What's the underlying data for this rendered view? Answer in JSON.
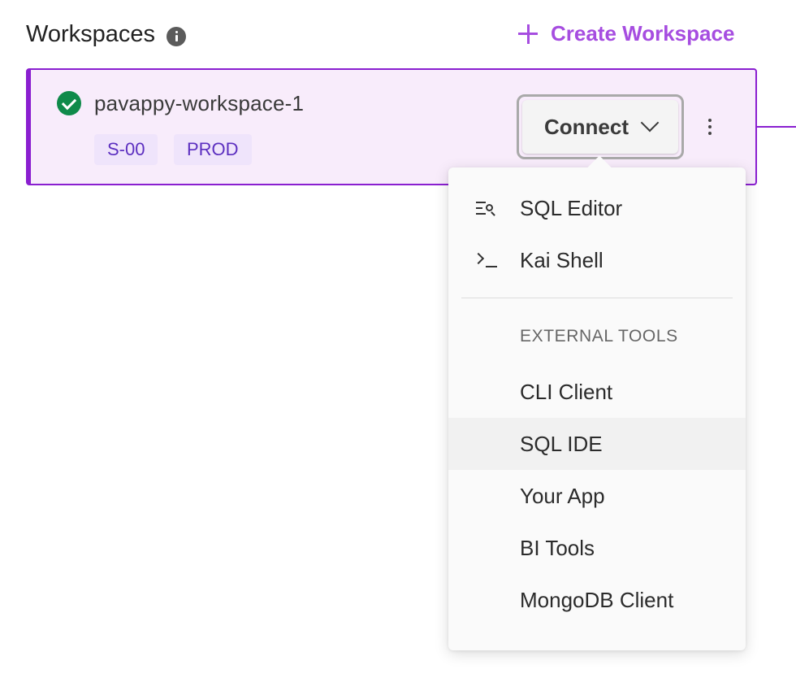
{
  "header": {
    "title": "Workspaces",
    "create_label": "Create Workspace",
    "accent_color": "#a64de0"
  },
  "workspace": {
    "name": "pavappy-workspace-1",
    "status": "running",
    "status_color": "#0f8a4a",
    "tags": [
      "S-00",
      "PROD"
    ],
    "connect_label": "Connect",
    "border_color": "#8a1fd0"
  },
  "connect_menu": {
    "primary_items": [
      {
        "label": "SQL Editor",
        "icon": "sql-editor-icon"
      },
      {
        "label": "Kai Shell",
        "icon": "terminal-icon"
      }
    ],
    "external_header": "EXTERNAL TOOLS",
    "external_items": [
      {
        "label": "CLI Client"
      },
      {
        "label": "SQL IDE",
        "hovered": true
      },
      {
        "label": "Your App"
      },
      {
        "label": "BI Tools"
      },
      {
        "label": "MongoDB Client"
      }
    ]
  }
}
